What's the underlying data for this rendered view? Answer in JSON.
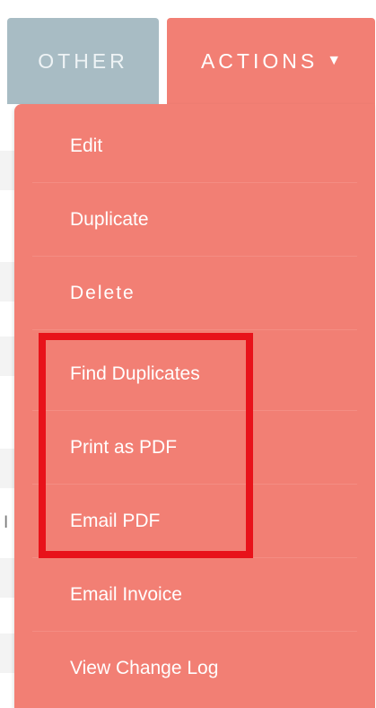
{
  "tabs": {
    "other_label": "OTHER",
    "actions_label": "ACTIONS",
    "actions_caret": "▼"
  },
  "background": {
    "edge_char": "I"
  },
  "menu": {
    "items": [
      {
        "label": "Edit"
      },
      {
        "label": "Duplicate"
      },
      {
        "label": "Delete"
      },
      {
        "label": "Find Duplicates"
      },
      {
        "label": "Print as PDF"
      },
      {
        "label": "Email PDF"
      },
      {
        "label": "Email Invoice"
      },
      {
        "label": "View Change Log"
      }
    ]
  },
  "annotation": {
    "highlight_color": "#e8121a",
    "highlighted_items": [
      "Find Duplicates",
      "Print as PDF",
      "Email PDF"
    ]
  },
  "colors": {
    "menu_background": "#f27f74",
    "other_tab": "#a8bcc4",
    "text": "#ffffff"
  }
}
